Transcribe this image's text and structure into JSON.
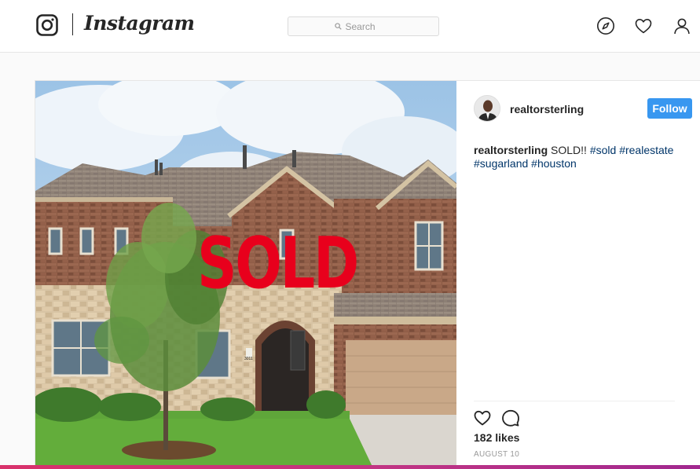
{
  "header": {
    "brand": "Instagram",
    "search_placeholder": "Search"
  },
  "post": {
    "author": "realtorsterling",
    "follow_label": "Follow",
    "photo_overlay_text": "SOLD",
    "house_number": "3011",
    "caption": {
      "username": "realtorsterling",
      "text": "SOLD!!",
      "hashtags": [
        "#sold",
        "#realestate",
        "#sugarland",
        "#houston"
      ]
    },
    "likes": "182 likes",
    "date": "AUGUST 10"
  },
  "colors": {
    "follow_button": "#3897f0",
    "hashtag": "#003569",
    "sold_text": "#e8001c"
  },
  "icons": [
    "instagram-camera-icon",
    "search-icon",
    "compass-icon",
    "heart-icon",
    "user-icon",
    "like-heart-icon",
    "comment-bubble-icon"
  ]
}
